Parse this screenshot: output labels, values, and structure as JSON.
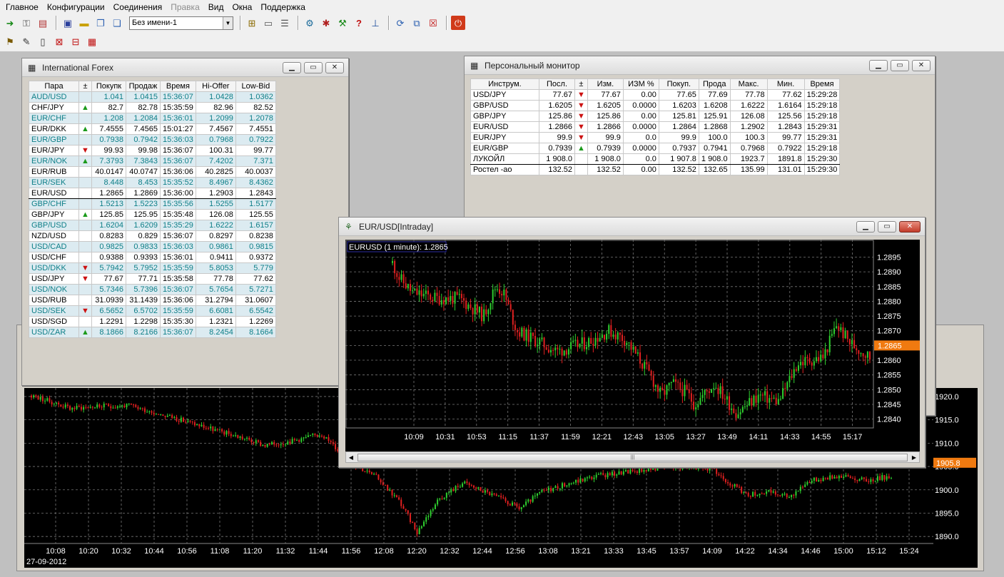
{
  "menu": [
    "Главное",
    "Конфигурации",
    "Соединения",
    "Правка",
    "Вид",
    "Окна",
    "Поддержка"
  ],
  "menu_disabled_index": 3,
  "toolbar": {
    "layout_combo": "Без имени-1"
  },
  "forex": {
    "title": "International Forex",
    "columns": [
      "Пара",
      "±",
      "Покупк",
      "Продаж",
      "Время",
      "Hi-Offer",
      "Low-Bid"
    ],
    "rows": [
      {
        "pair": "AUD/USD",
        "dir": "",
        "bid": "1.041",
        "ask": "1.0415",
        "time": "15:36:07",
        "hi": "1.0428",
        "lo": "1.0362",
        "style": "teal"
      },
      {
        "pair": "CHF/JPY",
        "dir": "up",
        "bid": "82.7",
        "ask": "82.78",
        "time": "15:35:59",
        "hi": "82.96",
        "lo": "82.52",
        "style": "black"
      },
      {
        "pair": "EUR/CHF",
        "dir": "",
        "bid": "1.208",
        "ask": "1.2084",
        "time": "15:36:01",
        "hi": "1.2099",
        "lo": "1.2078",
        "style": "teal"
      },
      {
        "pair": "EUR/DKK",
        "dir": "up",
        "bid": "7.4555",
        "ask": "7.4565",
        "time": "15:01:27",
        "hi": "7.4567",
        "lo": "7.4551",
        "style": "black"
      },
      {
        "pair": "EUR/GBP",
        "dir": "",
        "bid": "0.7938",
        "ask": "0.7942",
        "time": "15:36:03",
        "hi": "0.7968",
        "lo": "0.7922",
        "style": "teal"
      },
      {
        "pair": "EUR/JPY",
        "dir": "down",
        "bid": "99.93",
        "ask": "99.98",
        "time": "15:36:07",
        "hi": "100.31",
        "lo": "99.77",
        "style": "black"
      },
      {
        "pair": "EUR/NOK",
        "dir": "up",
        "bid": "7.3793",
        "ask": "7.3843",
        "time": "15:36:07",
        "hi": "7.4202",
        "lo": "7.371",
        "style": "teal"
      },
      {
        "pair": "EUR/RUB",
        "dir": "",
        "bid": "40.0147",
        "ask": "40.0747",
        "time": "15:36:06",
        "hi": "40.2825",
        "lo": "40.0037",
        "style": "black"
      },
      {
        "pair": "EUR/SEK",
        "dir": "",
        "bid": "8.448",
        "ask": "8.453",
        "time": "15:35:52",
        "hi": "8.4967",
        "lo": "8.4362",
        "style": "teal"
      },
      {
        "pair": "EUR/USD",
        "dir": "",
        "bid": "1.2865",
        "ask": "1.2869",
        "time": "15:36:00",
        "hi": "1.2903",
        "lo": "1.2843",
        "style": "black",
        "selected": true
      },
      {
        "pair": "GBP/CHF",
        "dir": "",
        "bid": "1.5213",
        "ask": "1.5223",
        "time": "15:35:56",
        "hi": "1.5255",
        "lo": "1.5177",
        "style": "teal"
      },
      {
        "pair": "GBP/JPY",
        "dir": "up",
        "bid": "125.85",
        "ask": "125.95",
        "time": "15:35:48",
        "hi": "126.08",
        "lo": "125.55",
        "style": "black"
      },
      {
        "pair": "GBP/USD",
        "dir": "",
        "bid": "1.6204",
        "ask": "1.6209",
        "time": "15:35:29",
        "hi": "1.6222",
        "lo": "1.6157",
        "style": "teal"
      },
      {
        "pair": "NZD/USD",
        "dir": "",
        "bid": "0.8283",
        "ask": "0.829",
        "time": "15:36:07",
        "hi": "0.8297",
        "lo": "0.8238",
        "style": "black"
      },
      {
        "pair": "USD/CAD",
        "dir": "",
        "bid": "0.9825",
        "ask": "0.9833",
        "time": "15:36:03",
        "hi": "0.9861",
        "lo": "0.9815",
        "style": "teal"
      },
      {
        "pair": "USD/CHF",
        "dir": "",
        "bid": "0.9388",
        "ask": "0.9393",
        "time": "15:36:01",
        "hi": "0.9411",
        "lo": "0.9372",
        "style": "black"
      },
      {
        "pair": "USD/DKK",
        "dir": "down",
        "bid": "5.7942",
        "ask": "5.7952",
        "time": "15:35:59",
        "hi": "5.8053",
        "lo": "5.779",
        "style": "teal"
      },
      {
        "pair": "USD/JPY",
        "dir": "down",
        "bid": "77.67",
        "ask": "77.71",
        "time": "15:35:58",
        "hi": "77.78",
        "lo": "77.62",
        "style": "black"
      },
      {
        "pair": "USD/NOK",
        "dir": "",
        "bid": "5.7346",
        "ask": "5.7396",
        "time": "15:36:07",
        "hi": "5.7654",
        "lo": "5.7271",
        "style": "teal"
      },
      {
        "pair": "USD/RUB",
        "dir": "",
        "bid": "31.0939",
        "ask": "31.1439",
        "time": "15:36:06",
        "hi": "31.2794",
        "lo": "31.0607",
        "style": "black"
      },
      {
        "pair": "USD/SEK",
        "dir": "down",
        "bid": "6.5652",
        "ask": "6.5702",
        "time": "15:35:59",
        "hi": "6.6081",
        "lo": "6.5542",
        "style": "teal"
      },
      {
        "pair": "USD/SGD",
        "dir": "",
        "bid": "1.2291",
        "ask": "1.2298",
        "time": "15:35:30",
        "hi": "1.2321",
        "lo": "1.2269",
        "style": "black"
      },
      {
        "pair": "USD/ZAR",
        "dir": "up",
        "bid": "8.1866",
        "ask": "8.2166",
        "time": "15:36:07",
        "hi": "8.2454",
        "lo": "8.1664",
        "style": "teal"
      }
    ]
  },
  "monitor": {
    "title": "Персональный монитор",
    "columns": [
      "Инструм.",
      "Посл.",
      "±",
      "Изм.",
      "ИЗМ %",
      "Покуп.",
      "Прода",
      "Макс.",
      "Мин.",
      "Время"
    ],
    "rows": [
      {
        "inst": "USD/JPY",
        "last": "77.67",
        "dir": "down",
        "chg": "77.67",
        "pct": "0.00",
        "bid": "77.65",
        "ask": "77.69",
        "hi": "77.78",
        "lo": "77.62",
        "time": "15:29:28"
      },
      {
        "inst": "GBP/USD",
        "last": "1.6205",
        "dir": "down",
        "chg": "1.6205",
        "pct": "0.0000",
        "bid": "1.6203",
        "ask": "1.6208",
        "hi": "1.6222",
        "lo": "1.6164",
        "time": "15:29:18"
      },
      {
        "inst": "GBP/JPY",
        "last": "125.86",
        "dir": "down",
        "chg": "125.86",
        "pct": "0.00",
        "bid": "125.81",
        "ask": "125.91",
        "hi": "126.08",
        "lo": "125.56",
        "time": "15:29:18"
      },
      {
        "inst": "EUR/USD",
        "last": "1.2866",
        "dir": "down",
        "chg": "1.2866",
        "pct": "0.0000",
        "bid": "1.2864",
        "ask": "1.2868",
        "hi": "1.2902",
        "lo": "1.2843",
        "time": "15:29:31"
      },
      {
        "inst": "EUR/JPY",
        "last": "99.9",
        "dir": "down",
        "chg": "99.9",
        "pct": "0.0",
        "bid": "99.9",
        "ask": "100.0",
        "hi": "100.3",
        "lo": "99.77",
        "time": "15:29:31"
      },
      {
        "inst": "EUR/GBP",
        "last": "0.7939",
        "dir": "up",
        "chg": "0.7939",
        "pct": "0.0000",
        "bid": "0.7937",
        "ask": "0.7941",
        "hi": "0.7968",
        "lo": "0.7922",
        "time": "15:29:18"
      },
      {
        "inst": "ЛУКОЙЛ",
        "last": "1 908.0",
        "dir": "",
        "chg": "1 908.0",
        "pct": "0.0",
        "bid": "1 907.8",
        "ask": "1 908.0",
        "hi": "1923.7",
        "lo": "1891.8",
        "time": "15:29:30",
        "selected": true
      },
      {
        "inst": "Ростел -ао",
        "last": "132.52",
        "dir": "",
        "chg": "132.52",
        "pct": "0.00",
        "bid": "132.52",
        "ask": "132.65",
        "hi": "135.99",
        "lo": "131.01",
        "time": "15:29:30"
      }
    ]
  },
  "eurusd_chart": {
    "window_title": "EUR/USD[Intraday]",
    "legend": "EURUSD (1 minute): 1.2865",
    "price_label": "1.2865",
    "chart_data": {
      "type": "candlestick",
      "xticks": [
        "10:09",
        "10:31",
        "10:53",
        "11:15",
        "11:37",
        "11:59",
        "12:21",
        "12:43",
        "13:05",
        "13:27",
        "13:49",
        "14:11",
        "14:33",
        "14:55",
        "15:17"
      ],
      "yticks": [
        "1.2895",
        "1.2890",
        "1.2885",
        "1.2880",
        "1.2875",
        "1.2870",
        "1.2865",
        "1.2860",
        "1.2855",
        "1.2850",
        "1.2845",
        "1.2840"
      ],
      "ylim": [
        1.2837,
        1.2899
      ],
      "current": 1.2865,
      "path": [
        [
          0,
          1.2893
        ],
        [
          6,
          1.2888
        ],
        [
          18,
          1.2883
        ],
        [
          40,
          1.2881
        ],
        [
          60,
          1.2881
        ],
        [
          82,
          1.2875
        ],
        [
          93,
          1.2885
        ],
        [
          100,
          1.2883
        ],
        [
          112,
          1.287
        ],
        [
          148,
          1.2863
        ],
        [
          175,
          1.2866
        ],
        [
          195,
          1.287
        ],
        [
          210,
          1.2867
        ],
        [
          232,
          1.2855
        ],
        [
          242,
          1.2848
        ],
        [
          252,
          1.2852
        ],
        [
          265,
          1.2849
        ],
        [
          272,
          1.2845
        ],
        [
          290,
          1.2852
        ],
        [
          310,
          1.2842
        ],
        [
          330,
          1.2848
        ],
        [
          348,
          1.2846
        ],
        [
          365,
          1.2859
        ],
        [
          388,
          1.2861
        ],
        [
          400,
          1.2872
        ],
        [
          412,
          1.2866
        ],
        [
          430,
          1.2861
        ]
      ]
    }
  },
  "lukoil_chart": {
    "date_label": "27-09-2012",
    "price_label": "1905.8",
    "chart_data": {
      "type": "candlestick",
      "xticks": [
        "10:08",
        "10:20",
        "10:32",
        "10:44",
        "10:56",
        "11:08",
        "11:20",
        "11:32",
        "11:44",
        "11:56",
        "12:08",
        "12:20",
        "12:32",
        "12:44",
        "12:56",
        "13:08",
        "13:21",
        "13:33",
        "13:45",
        "13:57",
        "14:09",
        "14:22",
        "14:34",
        "14:46",
        "15:00",
        "15:12",
        "15:24"
      ],
      "yticks": [
        "1920.0",
        "1915.0",
        "1910.0",
        "1905.0",
        "1900.0",
        "1895.0",
        "1890.0"
      ],
      "ylim": [
        1888.5,
        1920.6
      ],
      "current": 1905.8,
      "path": [
        [
          0,
          1920.2
        ],
        [
          25,
          1919.0
        ],
        [
          55,
          1917.5
        ],
        [
          95,
          1917.9
        ],
        [
          140,
          1918.0
        ],
        [
          200,
          1915.5
        ],
        [
          255,
          1913.0
        ],
        [
          290,
          1911.5
        ],
        [
          330,
          1909.5
        ],
        [
          370,
          1910.5
        ],
        [
          410,
          1912.0
        ],
        [
          450,
          1906.0
        ],
        [
          490,
          1902.5
        ],
        [
          520,
          1897.5
        ],
        [
          545,
          1891.0
        ],
        [
          575,
          1898.0
        ],
        [
          610,
          1901.5
        ],
        [
          650,
          1899.0
        ],
        [
          690,
          1896.0
        ],
        [
          720,
          1899.5
        ],
        [
          750,
          1901.0
        ],
        [
          800,
          1903.0
        ],
        [
          850,
          1904.0
        ],
        [
          900,
          1905.0
        ],
        [
          960,
          1904.5
        ],
        [
          1010,
          1899.0
        ],
        [
          1040,
          1899.5
        ],
        [
          1070,
          1898.5
        ],
        [
          1100,
          1902.0
        ],
        [
          1140,
          1903.0
        ],
        [
          1180,
          1902.0
        ],
        [
          1215,
          1903.0
        ]
      ]
    }
  }
}
